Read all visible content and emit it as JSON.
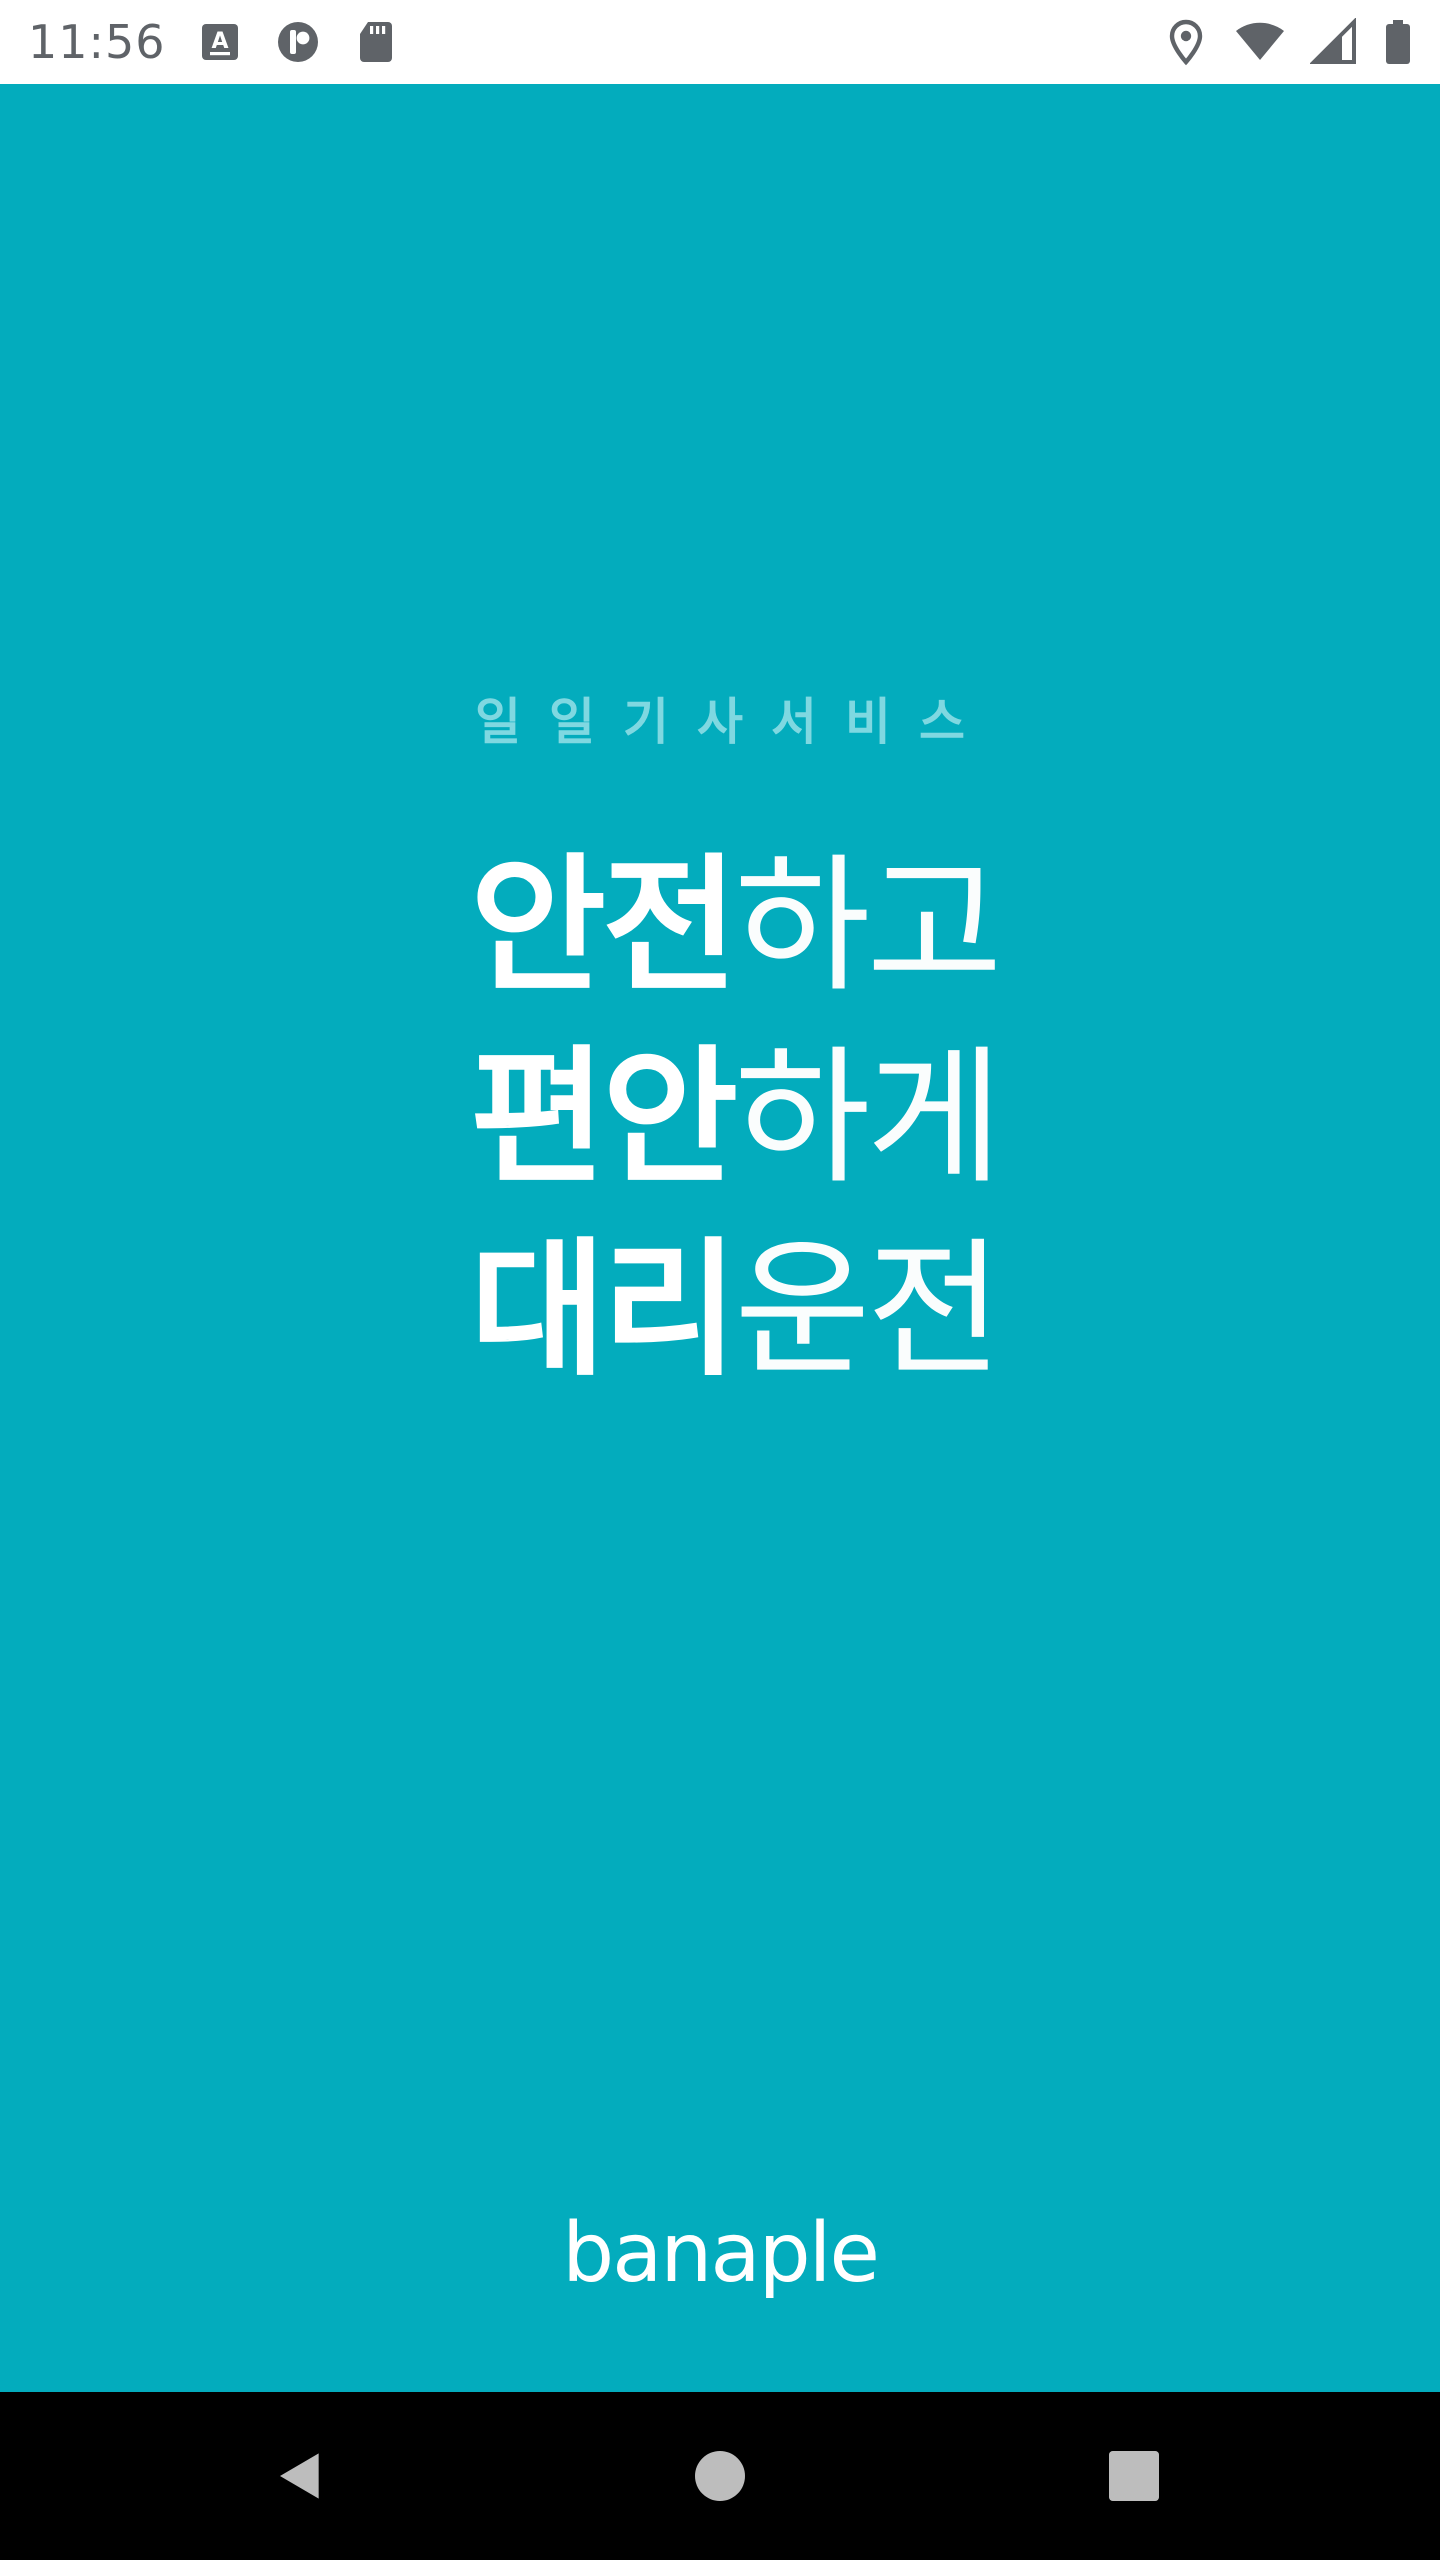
{
  "status_bar": {
    "time": "11:56",
    "left_icons": [
      "keyboard-a-icon",
      "app-notification-icon",
      "sd-card-icon"
    ],
    "right_icons": [
      "location-icon",
      "wifi-icon",
      "signal-icon",
      "battery-icon"
    ]
  },
  "splash": {
    "subtitle": "일일기사서비스",
    "headline": [
      {
        "bold": "안전",
        "light": "하고"
      },
      {
        "bold": "편안",
        "light": "하게"
      },
      {
        "bold": "대리",
        "light": "운전"
      }
    ],
    "logo": "banaple",
    "background_color": "#03acbd"
  },
  "nav_bar": {
    "buttons": [
      "back-icon",
      "home-icon",
      "recents-icon"
    ]
  }
}
